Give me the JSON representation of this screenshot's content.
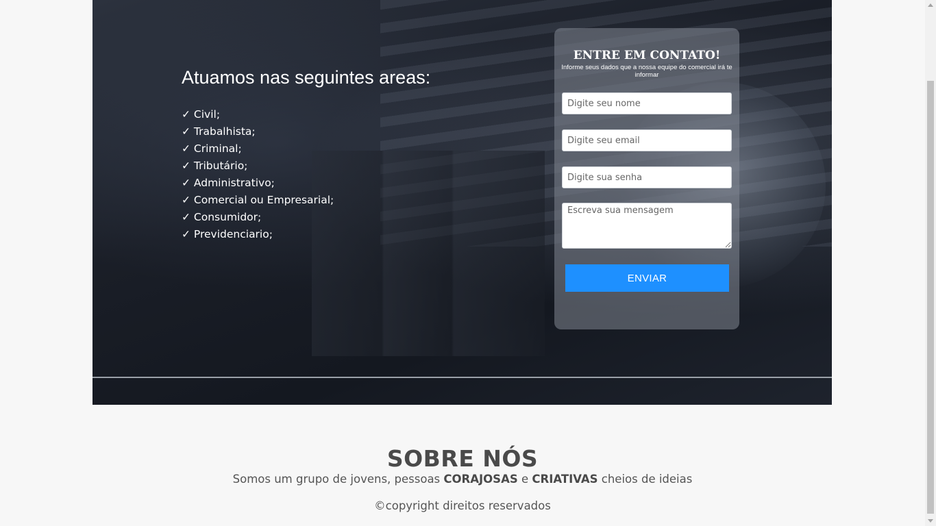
{
  "hero": {
    "areas_title": "Atuamos nas seguintes areas:",
    "areas": [
      "✓ Civil;",
      "✓ Trabalhista;",
      "✓ Criminal;",
      "✓ Tributário;",
      "✓ Administrativo;",
      "✓ Comercial ou Empresarial;",
      "✓ Consumidor;",
      "✓ Previdenciario;"
    ]
  },
  "contact": {
    "title": "ENTRE EM CONTATO!",
    "subtitle": "Informe seus dados que a nossa equipe do comercial irá te informar",
    "name_placeholder": "Digite seu nome",
    "email_placeholder": "Digite seu email",
    "password_placeholder": "Digite sua senha",
    "message_placeholder": "Escreva sua mensagem",
    "send_label": "ENVIAR",
    "send_color": "#1e90ff"
  },
  "about": {
    "title": "SOBRE NÓS",
    "text_part1": "Somos um grupo de jovens, pessoas ",
    "bold1": "CORAJOSAS",
    "text_part2": " e ",
    "bold2": "CRIATIVAS",
    "text_part3": " cheios de ideias"
  },
  "footer": {
    "copyright": "©copyright direitos reservados"
  }
}
